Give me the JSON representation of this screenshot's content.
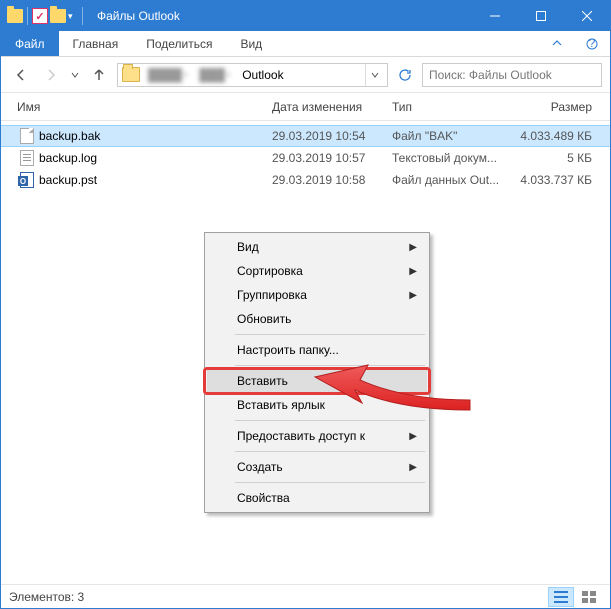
{
  "window_title": "Файлы Outlook",
  "ribbon": {
    "file": "Файл",
    "home": "Главная",
    "share": "Поделиться",
    "view": "Вид"
  },
  "breadcrumb": {
    "folder": "Outlook"
  },
  "search": {
    "placeholder": "Поиск: Файлы Outlook"
  },
  "columns": {
    "name": "Имя",
    "date": "Дата изменения",
    "type": "Тип",
    "size": "Размер"
  },
  "files": [
    {
      "name": "backup.bak",
      "date": "29.03.2019 10:54",
      "type": "Файл \"BAK\"",
      "size": "4.033.489 КБ"
    },
    {
      "name": "backup.log",
      "date": "29.03.2019 10:57",
      "type": "Текстовый докум...",
      "size": "5 КБ"
    },
    {
      "name": "backup.pst",
      "date": "29.03.2019 10:58",
      "type": "Файл данных Out...",
      "size": "4.033.737 КБ"
    }
  ],
  "context_menu": {
    "view": "Вид",
    "sort": "Сортировка",
    "group": "Группировка",
    "refresh": "Обновить",
    "customize": "Настроить папку...",
    "paste": "Вставить",
    "paste_shortcut": "Вставить ярлык",
    "give_access": "Предоставить доступ к",
    "new": "Создать",
    "properties": "Свойства"
  },
  "status": {
    "items": "Элементов: 3"
  }
}
